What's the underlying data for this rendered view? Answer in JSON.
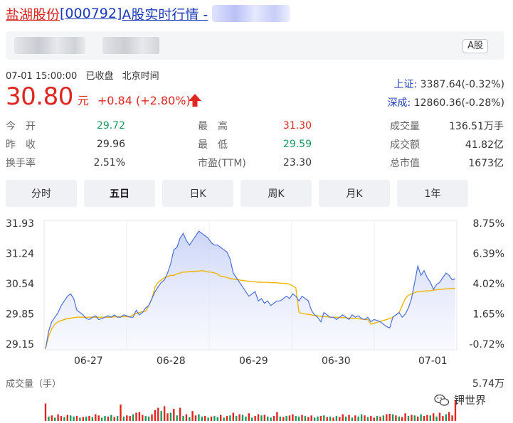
{
  "title": {
    "name": "盐湖股份",
    "code": "[000792]",
    "suffix": "A股实时行情 -"
  },
  "info_bar": {
    "market_tag": "A股"
  },
  "quote": {
    "datetime": "07-01 15:00:00",
    "status": "已收盘",
    "timezone": "北京时间",
    "price": "30.80",
    "unit": "元",
    "change": "+0.84 (+2.80%)"
  },
  "indices": [
    {
      "name": "上证:",
      "value": "3387.64(-0.32%)"
    },
    {
      "name": "深成:",
      "value": "12860.36(-0.28%)"
    }
  ],
  "stats": {
    "col1": [
      {
        "label": "今　开",
        "value": "29.72",
        "color": "green"
      },
      {
        "label": "昨　收",
        "value": "29.96",
        "color": "dark"
      },
      {
        "label": "换手率",
        "value": "2.51%",
        "color": "dark"
      }
    ],
    "col2": [
      {
        "label": "最　高",
        "value": "31.30",
        "color": "red"
      },
      {
        "label": "最　低",
        "value": "29.59",
        "color": "green"
      },
      {
        "label": "市盈(TTM)",
        "value": "23.30",
        "color": "dark"
      }
    ],
    "col3": [
      {
        "label": "成交量",
        "value": "136.51万手",
        "color": "dark"
      },
      {
        "label": "成交额",
        "value": "41.82亿",
        "color": "dark"
      },
      {
        "label": "总市值",
        "value": "1673亿",
        "color": "dark"
      }
    ]
  },
  "tabs": [
    {
      "label": "分时",
      "active": false
    },
    {
      "label": "五日",
      "active": true
    },
    {
      "label": "日K",
      "active": false
    },
    {
      "label": "周K",
      "active": false
    },
    {
      "label": "月K",
      "active": false
    },
    {
      "label": "1年",
      "active": false
    }
  ],
  "watermark": {
    "text": "钾世界"
  },
  "colors": {
    "up": "#e0261f",
    "down": "#199a5c",
    "price_line": "#4c6fd9",
    "avg_line": "#f2b400",
    "link_blue": "#1c39bb"
  },
  "chart_data": {
    "type": "line",
    "ylim": [
      29.15,
      31.93
    ],
    "y_ticks": [
      "31.93",
      "31.24",
      "30.54",
      "29.85",
      "29.15"
    ],
    "y_pct_ticks": [
      "8.75%",
      "6.39%",
      "4.02%",
      "1.65%",
      "-0.72%"
    ],
    "x_days": [
      "06-27",
      "06-28",
      "06-29",
      "06-30",
      "07-01"
    ],
    "volume_label": "成交量（手）",
    "volume_max_label": "5.74万",
    "volume_max": 57400,
    "series": [
      {
        "values": [
          29.17,
          29.55,
          29.75,
          29.85,
          29.95,
          30.1,
          30.2,
          30.3,
          30.35,
          30.25,
          30.0,
          29.95,
          29.9,
          29.82,
          29.8,
          29.85,
          29.88,
          29.8,
          29.82,
          29.85,
          29.88,
          29.85,
          29.9,
          29.85,
          29.85,
          29.9,
          29.88,
          29.85,
          29.85,
          30.0,
          29.9,
          29.95,
          30.05,
          30.1,
          30.25,
          30.4,
          30.5,
          30.6,
          30.65,
          30.8,
          31.0,
          31.3,
          31.35,
          31.55,
          31.65,
          31.5,
          31.4,
          31.5,
          31.6,
          31.7,
          31.65,
          31.6,
          31.55,
          31.45,
          31.4,
          31.4,
          31.35,
          31.3,
          31.25,
          31.1,
          30.8,
          30.7,
          30.6,
          30.5,
          30.4,
          30.3,
          30.35,
          30.4,
          30.2,
          30.25,
          30.15,
          30.2,
          30.1,
          30.15,
          30.2,
          30.2,
          30.25,
          30.3,
          30.25,
          30.35,
          30.3,
          30.2,
          30.3,
          30.25,
          30.2,
          30.0,
          29.9,
          29.85,
          29.75,
          29.95,
          29.9,
          29.85,
          29.85,
          29.8,
          29.85,
          29.9,
          29.85,
          29.8,
          29.9,
          29.85,
          29.88,
          29.82,
          29.8,
          29.85,
          29.75,
          29.8,
          29.78,
          29.75,
          29.7,
          29.65,
          29.62,
          29.85,
          29.9,
          29.95,
          29.85,
          29.92,
          30.05,
          30.25,
          30.6,
          30.95,
          30.75,
          30.85,
          30.7,
          30.6,
          30.45,
          30.55,
          30.6,
          30.7,
          30.8,
          30.75,
          30.65,
          30.68
        ],
        "color": "#4c6fd9"
      },
      {
        "values": [
          29.17,
          29.45,
          29.6,
          29.7,
          29.75,
          29.78,
          29.8,
          29.82,
          29.83,
          29.84,
          29.85,
          29.85,
          29.85,
          29.85,
          29.85,
          29.85,
          29.85,
          29.85,
          29.85,
          29.85,
          29.85,
          29.85,
          29.86,
          29.86,
          29.86,
          29.86,
          29.86,
          29.86,
          29.9,
          29.93,
          29.95,
          29.97,
          29.98,
          30.1,
          30.25,
          30.5,
          30.6,
          30.65,
          30.7,
          30.72,
          30.75,
          30.75,
          30.78,
          30.8,
          30.82,
          30.82,
          30.83,
          30.83,
          30.84,
          30.84,
          30.85,
          30.84,
          30.82,
          30.82,
          30.8,
          30.78,
          30.73,
          30.72,
          30.7,
          30.68,
          30.67,
          30.66,
          30.65,
          30.64,
          30.63,
          30.62,
          30.62,
          30.61,
          30.6,
          30.6,
          30.6,
          30.6,
          30.59,
          30.59,
          30.59,
          30.58,
          30.58,
          30.57,
          30.56,
          30.52,
          30.48,
          29.95,
          29.93,
          29.92,
          29.91,
          29.9,
          29.89,
          29.88,
          29.87,
          29.86,
          29.86,
          29.85,
          29.85,
          29.85,
          29.84,
          29.84,
          29.84,
          29.83,
          29.83,
          29.82,
          29.82,
          29.81,
          29.8,
          29.8,
          29.7,
          29.72,
          29.74,
          29.76,
          29.78,
          29.8,
          29.82,
          29.85,
          29.9,
          29.95,
          30.1,
          30.25,
          30.32,
          30.35,
          30.38,
          30.4,
          30.4,
          30.41,
          30.42,
          30.42,
          30.43,
          30.44,
          30.45,
          30.45,
          30.46,
          30.46,
          30.47,
          30.47
        ]
      }
    ],
    "volume": [
      32000,
      8000,
      10000,
      6000,
      12000,
      9000,
      7000,
      11000,
      10000,
      8000,
      9000,
      6000,
      7000,
      8000,
      9000,
      7000,
      12000,
      10000,
      6000,
      9000,
      8000,
      11000,
      7000,
      9000,
      30000,
      8000,
      10000,
      9000,
      12000,
      15000,
      16000,
      11000,
      9000,
      8000,
      12000,
      20000,
      24000,
      18000,
      27000,
      14000,
      15000,
      22000,
      10000,
      24000,
      9000,
      12000,
      7000,
      18000,
      10000,
      12000,
      8000,
      9000,
      6000,
      8000,
      9000,
      7000,
      11000,
      6000,
      9000,
      10000,
      15000,
      9000,
      12000,
      11000,
      8000,
      14000,
      6000,
      9000,
      12000,
      10000,
      11000,
      8000,
      6000,
      9000,
      16000,
      8000,
      7000,
      9000,
      10000,
      12000,
      9000,
      8000,
      11000,
      9000,
      7000,
      10000,
      6000,
      8000,
      9000,
      10000,
      7000,
      8000,
      6000,
      9000,
      7000,
      12000,
      8000,
      11000,
      6000,
      10000,
      8000,
      12000,
      10000,
      7000,
      9000,
      6000,
      9000,
      8000,
      10000,
      12000,
      13000,
      12000,
      10000,
      8000,
      7000,
      14000,
      9000,
      11000,
      10000,
      8000,
      12000,
      9000,
      11000,
      10000,
      14000,
      8000,
      15000,
      9000,
      12000,
      16000,
      10000,
      38000
    ],
    "volume_direction": [
      1,
      0,
      1,
      0,
      1,
      1,
      0,
      1,
      0,
      0,
      1,
      0,
      1,
      0,
      1,
      0,
      1,
      1,
      0,
      0,
      1,
      0,
      1,
      0,
      1,
      0,
      1,
      1,
      0,
      1,
      1,
      1,
      0,
      0,
      1,
      1,
      1,
      0,
      1,
      1,
      0,
      1,
      0,
      1,
      0,
      1,
      0,
      1,
      1,
      0,
      0,
      1,
      0,
      1,
      0,
      0,
      1,
      0,
      1,
      0,
      1,
      0,
      1,
      0,
      0,
      1,
      0,
      1,
      1,
      0,
      1,
      0,
      0,
      1,
      1,
      0,
      1,
      0,
      1,
      1,
      0,
      0,
      1,
      0,
      1,
      1,
      0,
      0,
      1,
      0,
      1,
      0,
      1,
      0,
      1,
      1,
      0,
      1,
      0,
      1,
      0,
      0,
      1,
      0,
      1,
      1,
      0,
      1,
      0,
      1,
      1,
      0,
      1,
      0,
      1,
      1,
      0,
      1,
      0,
      1,
      0,
      1,
      1,
      0,
      1,
      0,
      1,
      1,
      0,
      1,
      1,
      1
    ]
  }
}
